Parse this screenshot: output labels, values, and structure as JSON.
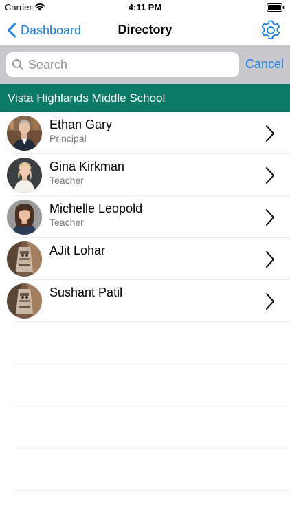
{
  "status_bar": {
    "carrier": "Carrier",
    "time": "4:11 PM"
  },
  "nav": {
    "back_label": "Dashboard",
    "title": "Directory"
  },
  "search": {
    "placeholder": "Search",
    "value": "",
    "cancel_label": "Cancel"
  },
  "section": {
    "title": "Vista Highlands Middle School"
  },
  "people": [
    {
      "name": "Ethan Gary",
      "role": "Principal"
    },
    {
      "name": "Gina Kirkman",
      "role": "Teacher"
    },
    {
      "name": "Michelle Leopold",
      "role": "Teacher"
    },
    {
      "name": "AJit Lohar",
      "role": ""
    },
    {
      "name": "Sushant Patil",
      "role": ""
    }
  ],
  "colors": {
    "accent": "#1a7ee6",
    "section_header": "#0c7a68",
    "search_bar_bg": "#c8c8cd"
  },
  "icons": [
    "wifi-icon",
    "battery-icon",
    "back-chevron-icon",
    "gear-icon",
    "search-icon",
    "chevron-right-icon"
  ]
}
